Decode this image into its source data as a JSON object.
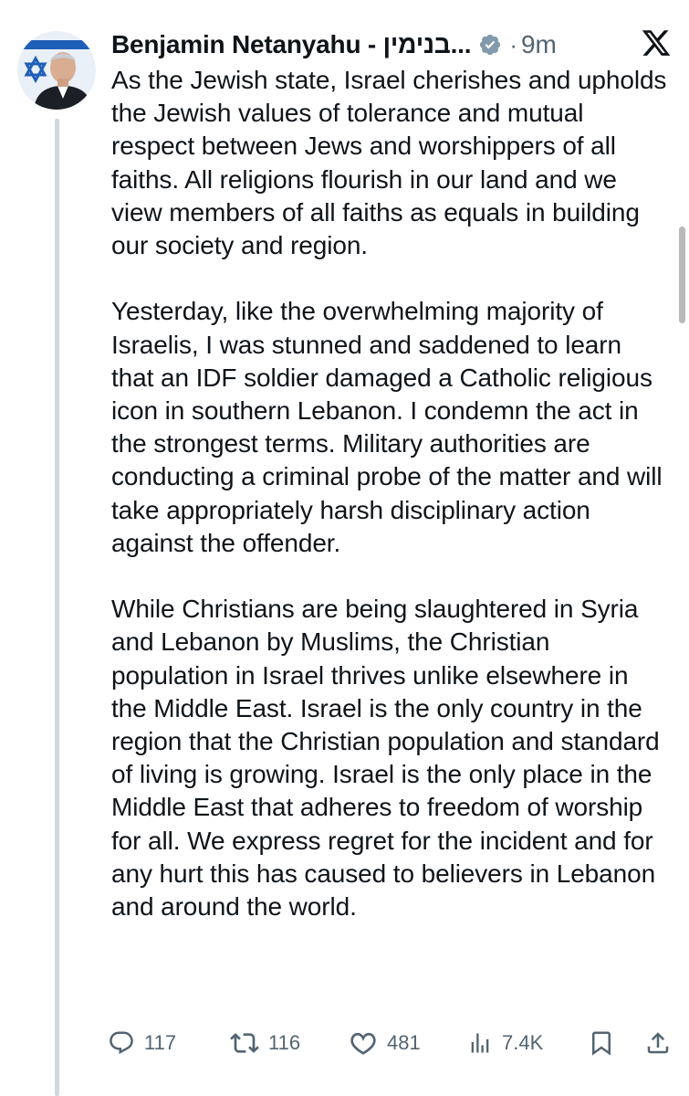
{
  "post": {
    "author": {
      "name": "Benjamin Netanyahu - בנימין...",
      "verified_icon": "verified-badge-icon",
      "avatar_icon": "avatar"
    },
    "separator": "·",
    "time_ago": "9m",
    "platform_icon": "x-logo-icon",
    "paragraphs": [
      "As the Jewish state, Israel cherishes and upholds the Jewish values of tolerance and mutual respect between Jews and worshippers of all faiths. All religions flourish in our land and we view members of all faiths as equals in building our society and region.",
      "Yesterday, like the overwhelming majority of Israelis, I was stunned and saddened to learn that an IDF soldier damaged a Catholic religious icon in southern Lebanon. I condemn the act in the strongest terms. Military authorities are conducting a criminal probe of the matter and will take appropriately harsh disciplinary action against the offender.",
      "While Christians are being slaughtered in Syria and Lebanon by Muslims, the Christian population in Israel thrives unlike elsewhere in the Middle East. Israel is the only country in the region that the Christian population and standard of living is growing. Israel is the only place in the Middle East that adheres to freedom of worship for all. We express regret for the incident and for any hurt this has caused to believers in Lebanon and around the world."
    ],
    "actions": {
      "replies": "117",
      "reposts": "116",
      "likes": "481",
      "views": "7.4K"
    }
  },
  "colors": {
    "text": "#0f1419",
    "secondary": "#536471",
    "verified": "#829aab",
    "thread_line": "#cfd9de"
  }
}
